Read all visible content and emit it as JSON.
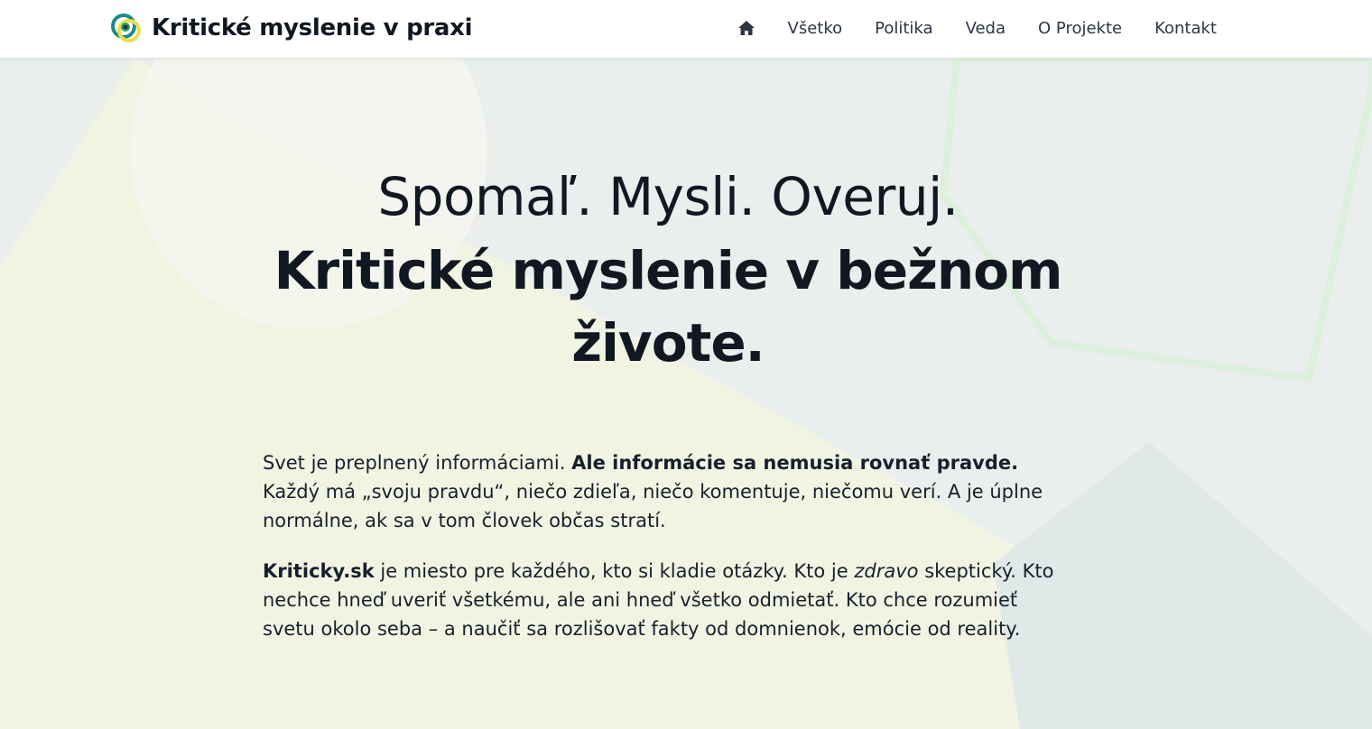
{
  "brand": {
    "title": "Kritické myslenie v praxi",
    "logo_icon": "eye-logo-icon"
  },
  "nav": {
    "home_icon": "home-icon",
    "items": [
      {
        "label": "Všetko"
      },
      {
        "label": "Politika"
      },
      {
        "label": "Veda"
      },
      {
        "label": "O Projekte"
      },
      {
        "label": "Kontakt"
      }
    ]
  },
  "hero": {
    "line1": "Spomaľ. Mysli. Overuj.",
    "line2": "Kritické myslenie v bežnom živote."
  },
  "intro": {
    "p1_start": "Svet je preplnený informáciami. ",
    "p1_bold": "Ale informácie sa nemusia rovnať pravde.",
    "p1_rest": " Každý má „svoju pravdu“, niečo zdieľa, niečo komentuje, niečomu verí. A je úplne normálne, ak sa v tom človek občas stratí.",
    "p2_bold": "Kriticky.sk",
    "p2_mid": " je miesto pre každého, kto si kladie otázky. Kto je ",
    "p2_em": "zdravo",
    "p2_rest": " skeptický. Kto nechce hneď uveriť všetkému, ale ani hneď všetko odmietať. Kto chce rozumieť svetu okolo seba – a naučiť sa rozlišovať fakty od domnienok, emócie od reality."
  },
  "colors": {
    "background": "#eef1ef",
    "yellow_shape": "#f1f3e2",
    "text_dark": "#111821",
    "nav_text": "#2c3644",
    "logo_teal": "#1d8a8a",
    "logo_yellow": "#e7e04a",
    "logo_navy": "#1d3040"
  }
}
